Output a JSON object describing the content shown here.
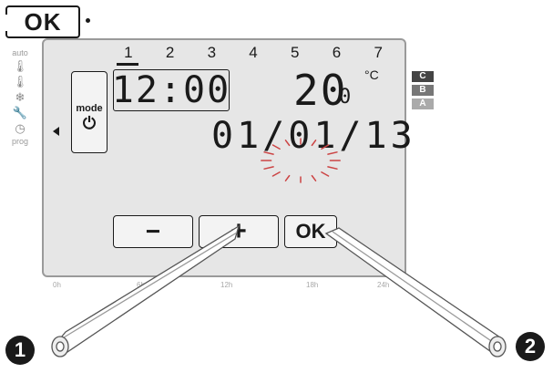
{
  "top_key": {
    "label": "OK"
  },
  "side": {
    "auto_label": "auto",
    "prog_label": "prog",
    "icons": [
      "thermometer-comfort-icon",
      "thermometer-eco-icon",
      "frost-icon",
      "wrench-icon",
      "clock-icon"
    ]
  },
  "days": [
    "1",
    "2",
    "3",
    "4",
    "5",
    "6",
    "7"
  ],
  "mode_button": {
    "label": "mode",
    "icon": "⏻"
  },
  "display": {
    "time": "12:00",
    "temp_int": "20",
    "temp_dec": "0",
    "temp_unit": "°C",
    "date": "01/01/13"
  },
  "badges": [
    {
      "label": "C",
      "color": "#444444"
    },
    {
      "label": "B",
      "color": "#777777"
    },
    {
      "label": "A",
      "color": "#aaaaaa"
    }
  ],
  "buttons": {
    "minus": "−",
    "plus": "+",
    "ok": "OK"
  },
  "timeline": [
    "0h",
    "6h",
    "12h",
    "18h",
    "24h"
  ],
  "steps": [
    "1",
    "2"
  ]
}
